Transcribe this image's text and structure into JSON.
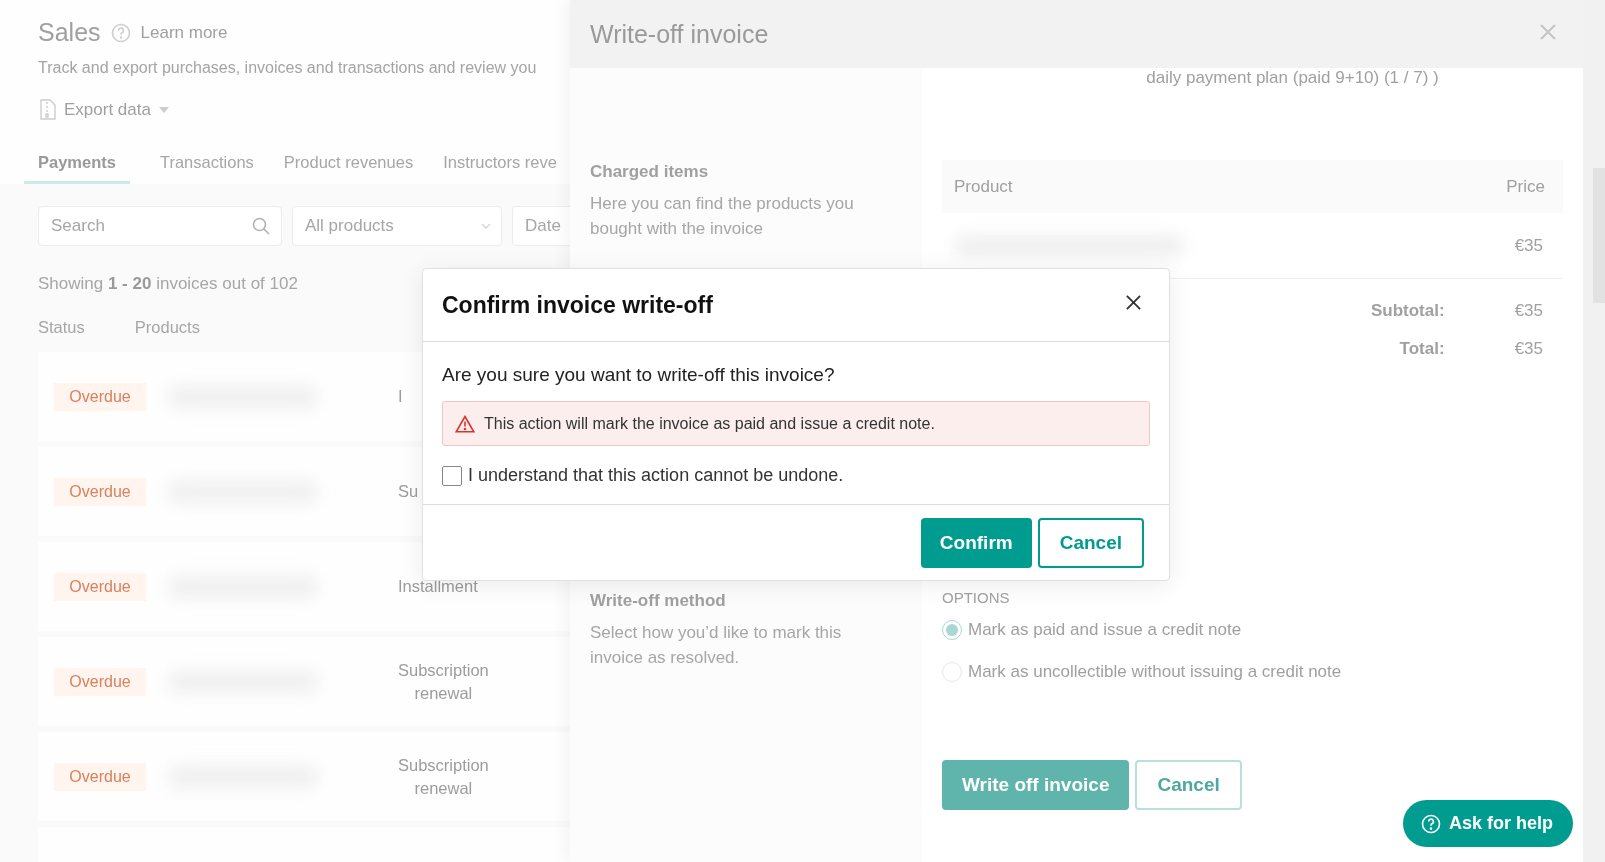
{
  "page": {
    "title": "Sales",
    "learn_more": "Learn more",
    "subtitle": "Track and export purchases, invoices and transactions and review you",
    "export": "Export data",
    "tabs": [
      {
        "label": "Payments",
        "selected": true
      },
      {
        "label": "Transactions",
        "selected": false
      },
      {
        "label": "Product revenues",
        "selected": false
      },
      {
        "label": "Instructors reve",
        "selected": false
      }
    ],
    "search": {
      "placeholder": "Search"
    },
    "product_filter": "All products",
    "date_filter": "Date",
    "summary": "Showing **1 - 20** invoices out of 102",
    "columns": [
      "Status",
      "Products"
    ],
    "rows": [
      {
        "status": "Overdue",
        "type": "I"
      },
      {
        "status": "Overdue",
        "type": "Su"
      },
      {
        "status": "Overdue",
        "type": "Installment"
      },
      {
        "status": "Overdue",
        "type": "Subscription renewal"
      },
      {
        "status": "Overdue",
        "type": "Subscription renewal"
      }
    ]
  },
  "drawer": {
    "title": "Write-off invoice",
    "plan": "daily payment plan (paid 9+10) (1 / 7) )",
    "sections": [
      {
        "title": "Charged items",
        "description": "Here you can find the products you bought with the invoice"
      },
      {
        "title": "Write-off method",
        "description": "Select how you’d like to mark this invoice as resolved."
      }
    ],
    "items_table": {
      "columns": [
        "Product",
        "Price"
      ],
      "rows": [
        {
          "price": "€35"
        }
      ]
    },
    "totals": [
      {
        "label": "Subtotal:",
        "value": "€35"
      },
      {
        "label": "Total:",
        "value": "€35"
      }
    ],
    "options_label": "OPTIONS",
    "options": [
      {
        "label": "Mark as paid and issue a credit note",
        "selected": true
      },
      {
        "label": "Mark as uncollectible without issuing a credit note",
        "selected": false
      }
    ],
    "primary_button": "Write off invoice",
    "secondary_button": "Cancel"
  },
  "modal": {
    "title": "Confirm invoice write-off",
    "question": "Are you sure you want to write-off this invoice?",
    "warning": "This action will mark the invoice as paid and issue a credit note.",
    "checkbox": {
      "label": "I understand that this action cannot be undone.",
      "checked": false
    },
    "confirm": "Confirm",
    "cancel": "Cancel"
  },
  "help_button": "Ask for help"
}
